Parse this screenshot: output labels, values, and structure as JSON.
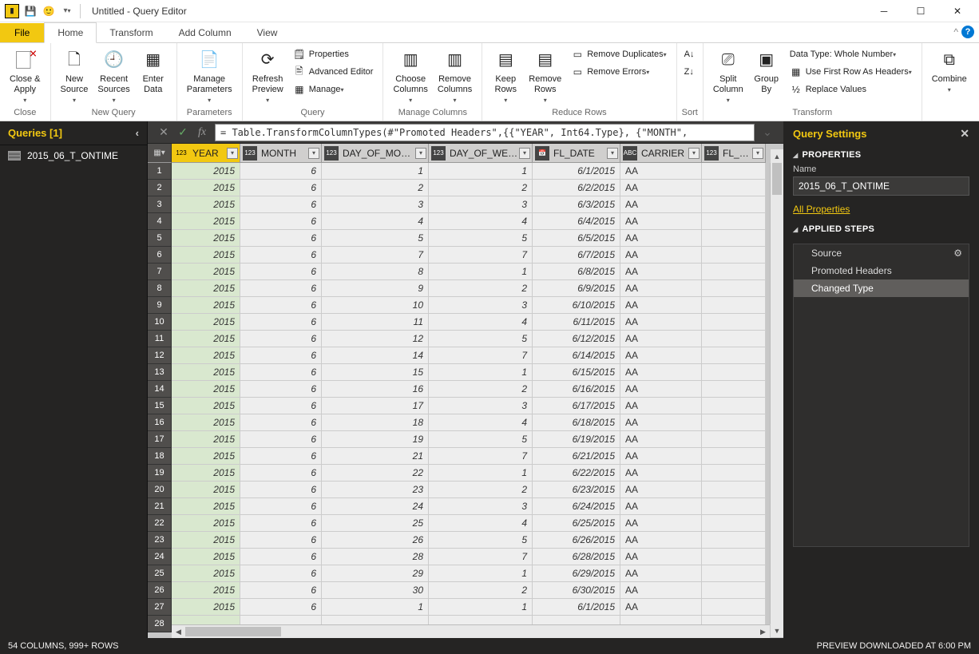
{
  "title": "Untitled - Query Editor",
  "tabs": {
    "file": "File",
    "home": "Home",
    "transform": "Transform",
    "addcol": "Add Column",
    "view": "View"
  },
  "ribbon": {
    "close_apply": "Close &\nApply",
    "close_group": "Close",
    "new_source": "New\nSource",
    "recent_sources": "Recent\nSources",
    "enter_data": "Enter\nData",
    "new_query_group": "New Query",
    "manage_params": "Manage\nParameters",
    "parameters_group": "Parameters",
    "refresh_preview": "Refresh\nPreview",
    "properties": "Properties",
    "advanced_editor": "Advanced Editor",
    "manage": "Manage",
    "query_group": "Query",
    "choose_cols": "Choose\nColumns",
    "remove_cols": "Remove\nColumns",
    "manage_cols_group": "Manage Columns",
    "keep_rows": "Keep\nRows",
    "remove_rows": "Remove\nRows",
    "remove_dupes": "Remove Duplicates",
    "remove_errors": "Remove Errors",
    "reduce_rows_group": "Reduce Rows",
    "sort_group": "Sort",
    "split_col": "Split\nColumn",
    "group_by": "Group\nBy",
    "data_type": "Data Type: Whole Number",
    "first_row_headers": "Use First Row As Headers",
    "replace_vals": "Replace Values",
    "transform_group": "Transform",
    "combine": "Combine"
  },
  "left": {
    "header": "Queries [1]",
    "items": [
      "2015_06_T_ONTIME"
    ]
  },
  "formula": "= Table.TransformColumnTypes(#\"Promoted Headers\",{{\"YEAR\", Int64.Type}, {\"MONTH\",",
  "columns": [
    {
      "name": "YEAR",
      "badge": "123",
      "sel": true
    },
    {
      "name": "MONTH",
      "badge": "123"
    },
    {
      "name": "DAY_OF_MONTH",
      "badge": "123"
    },
    {
      "name": "DAY_OF_WEEK",
      "badge": "123"
    },
    {
      "name": "FL_DATE",
      "badge": "📅"
    },
    {
      "name": "CARRIER",
      "badge": "ABC"
    },
    {
      "name": "FL_NUM",
      "badge": "123"
    }
  ],
  "rows": [
    [
      2015,
      6,
      1,
      1,
      "6/1/2015",
      "AA",
      ""
    ],
    [
      2015,
      6,
      2,
      2,
      "6/2/2015",
      "AA",
      ""
    ],
    [
      2015,
      6,
      3,
      3,
      "6/3/2015",
      "AA",
      ""
    ],
    [
      2015,
      6,
      4,
      4,
      "6/4/2015",
      "AA",
      ""
    ],
    [
      2015,
      6,
      5,
      5,
      "6/5/2015",
      "AA",
      ""
    ],
    [
      2015,
      6,
      7,
      7,
      "6/7/2015",
      "AA",
      ""
    ],
    [
      2015,
      6,
      8,
      1,
      "6/8/2015",
      "AA",
      ""
    ],
    [
      2015,
      6,
      9,
      2,
      "6/9/2015",
      "AA",
      ""
    ],
    [
      2015,
      6,
      10,
      3,
      "6/10/2015",
      "AA",
      ""
    ],
    [
      2015,
      6,
      11,
      4,
      "6/11/2015",
      "AA",
      ""
    ],
    [
      2015,
      6,
      12,
      5,
      "6/12/2015",
      "AA",
      ""
    ],
    [
      2015,
      6,
      14,
      7,
      "6/14/2015",
      "AA",
      ""
    ],
    [
      2015,
      6,
      15,
      1,
      "6/15/2015",
      "AA",
      ""
    ],
    [
      2015,
      6,
      16,
      2,
      "6/16/2015",
      "AA",
      ""
    ],
    [
      2015,
      6,
      17,
      3,
      "6/17/2015",
      "AA",
      ""
    ],
    [
      2015,
      6,
      18,
      4,
      "6/18/2015",
      "AA",
      ""
    ],
    [
      2015,
      6,
      19,
      5,
      "6/19/2015",
      "AA",
      ""
    ],
    [
      2015,
      6,
      21,
      7,
      "6/21/2015",
      "AA",
      ""
    ],
    [
      2015,
      6,
      22,
      1,
      "6/22/2015",
      "AA",
      ""
    ],
    [
      2015,
      6,
      23,
      2,
      "6/23/2015",
      "AA",
      ""
    ],
    [
      2015,
      6,
      24,
      3,
      "6/24/2015",
      "AA",
      ""
    ],
    [
      2015,
      6,
      25,
      4,
      "6/25/2015",
      "AA",
      ""
    ],
    [
      2015,
      6,
      26,
      5,
      "6/26/2015",
      "AA",
      ""
    ],
    [
      2015,
      6,
      28,
      7,
      "6/28/2015",
      "AA",
      ""
    ],
    [
      2015,
      6,
      29,
      1,
      "6/29/2015",
      "AA",
      ""
    ],
    [
      2015,
      6,
      30,
      2,
      "6/30/2015",
      "AA",
      ""
    ],
    [
      2015,
      6,
      1,
      1,
      "6/1/2015",
      "AA",
      ""
    ]
  ],
  "last_row_num": 28,
  "right": {
    "header": "Query Settings",
    "properties": "PROPERTIES",
    "name_label": "Name",
    "name_value": "2015_06_T_ONTIME",
    "all_props": "All Properties",
    "applied": "APPLIED STEPS",
    "steps": [
      "Source",
      "Promoted Headers",
      "Changed Type"
    ]
  },
  "status": {
    "left": "54 COLUMNS, 999+ ROWS",
    "right": "PREVIEW DOWNLOADED AT 6:00 PM"
  }
}
